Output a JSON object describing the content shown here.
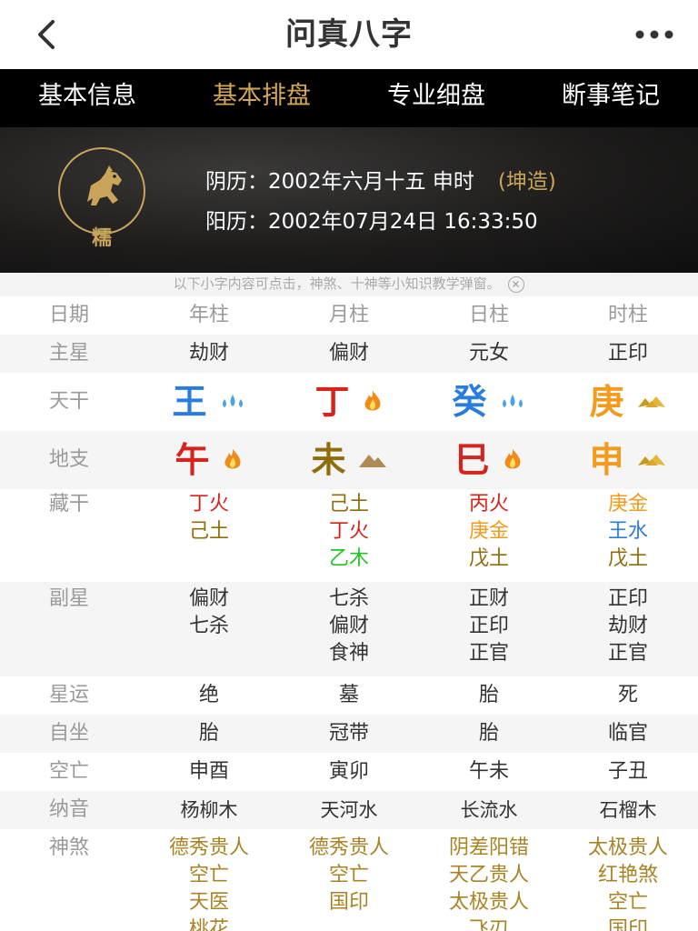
{
  "header": {
    "title": "问真八字"
  },
  "tabs": [
    {
      "label": "基本信息"
    },
    {
      "label": "基本排盘"
    },
    {
      "label": "专业细盘"
    },
    {
      "label": "断事笔记"
    }
  ],
  "profile": {
    "name": "糯",
    "lunar": "阴历：2002年六月十五 申时",
    "gender": "(坤造)",
    "solar": "阳历：2002年07月24日 16:33:50"
  },
  "notice": "以下小字内容可点击，神煞、十神等小知识教学弹窗。",
  "table": {
    "headers": [
      "日期",
      "年柱",
      "月柱",
      "日柱",
      "时柱"
    ],
    "main_star": {
      "label": "主星",
      "values": [
        "劫财",
        "偏财",
        "元女",
        "正印"
      ]
    },
    "tiangan": {
      "label": "天干",
      "values": [
        "王",
        "丁",
        "癸",
        "庚"
      ]
    },
    "dizhi": {
      "label": "地支",
      "values": [
        "午",
        "未",
        "巳",
        "申"
      ]
    },
    "canggan": {
      "label": "藏干",
      "cols": [
        [
          "丁火",
          "己土"
        ],
        [
          "己土",
          "丁火",
          "乙木"
        ],
        [
          "丙火",
          "庚金",
          "戊土"
        ],
        [
          "庚金",
          "王水",
          "戊土"
        ]
      ]
    },
    "fuxing": {
      "label": "副星",
      "cols": [
        [
          "偏财",
          "七杀"
        ],
        [
          "七杀",
          "偏财",
          "食神"
        ],
        [
          "正财",
          "正印",
          "正官"
        ],
        [
          "正印",
          "劫财",
          "正官"
        ]
      ]
    },
    "xingyun": {
      "label": "星运",
      "values": [
        "绝",
        "墓",
        "胎",
        "死"
      ]
    },
    "zizuo": {
      "label": "自坐",
      "values": [
        "胎",
        "冠带",
        "胎",
        "临官"
      ]
    },
    "kongwang": {
      "label": "空亡",
      "values": [
        "申酉",
        "寅卯",
        "午未",
        "子丑"
      ]
    },
    "nayin": {
      "label": "纳音",
      "values": [
        "杨柳木",
        "天河水",
        "长流水",
        "石榴木"
      ]
    },
    "shensha": {
      "label": "神煞",
      "cols": [
        [
          "德秀贵人",
          "空亡",
          "天医",
          "桃花"
        ],
        [
          "德秀贵人",
          "空亡",
          "国印"
        ],
        [
          "阴差阳错",
          "天乙贵人",
          "太极贵人",
          "飞刃"
        ],
        [
          "太极贵人",
          "红艳煞",
          "空亡",
          "国印"
        ]
      ]
    }
  },
  "colors": {
    "tab_active": "#d3a653",
    "fire": "#d6231b",
    "water": "#2a7de0",
    "metal": "#f29b1c",
    "earth": "#8e6e0c",
    "wood": "#27c227",
    "shensha": "#a88424"
  }
}
